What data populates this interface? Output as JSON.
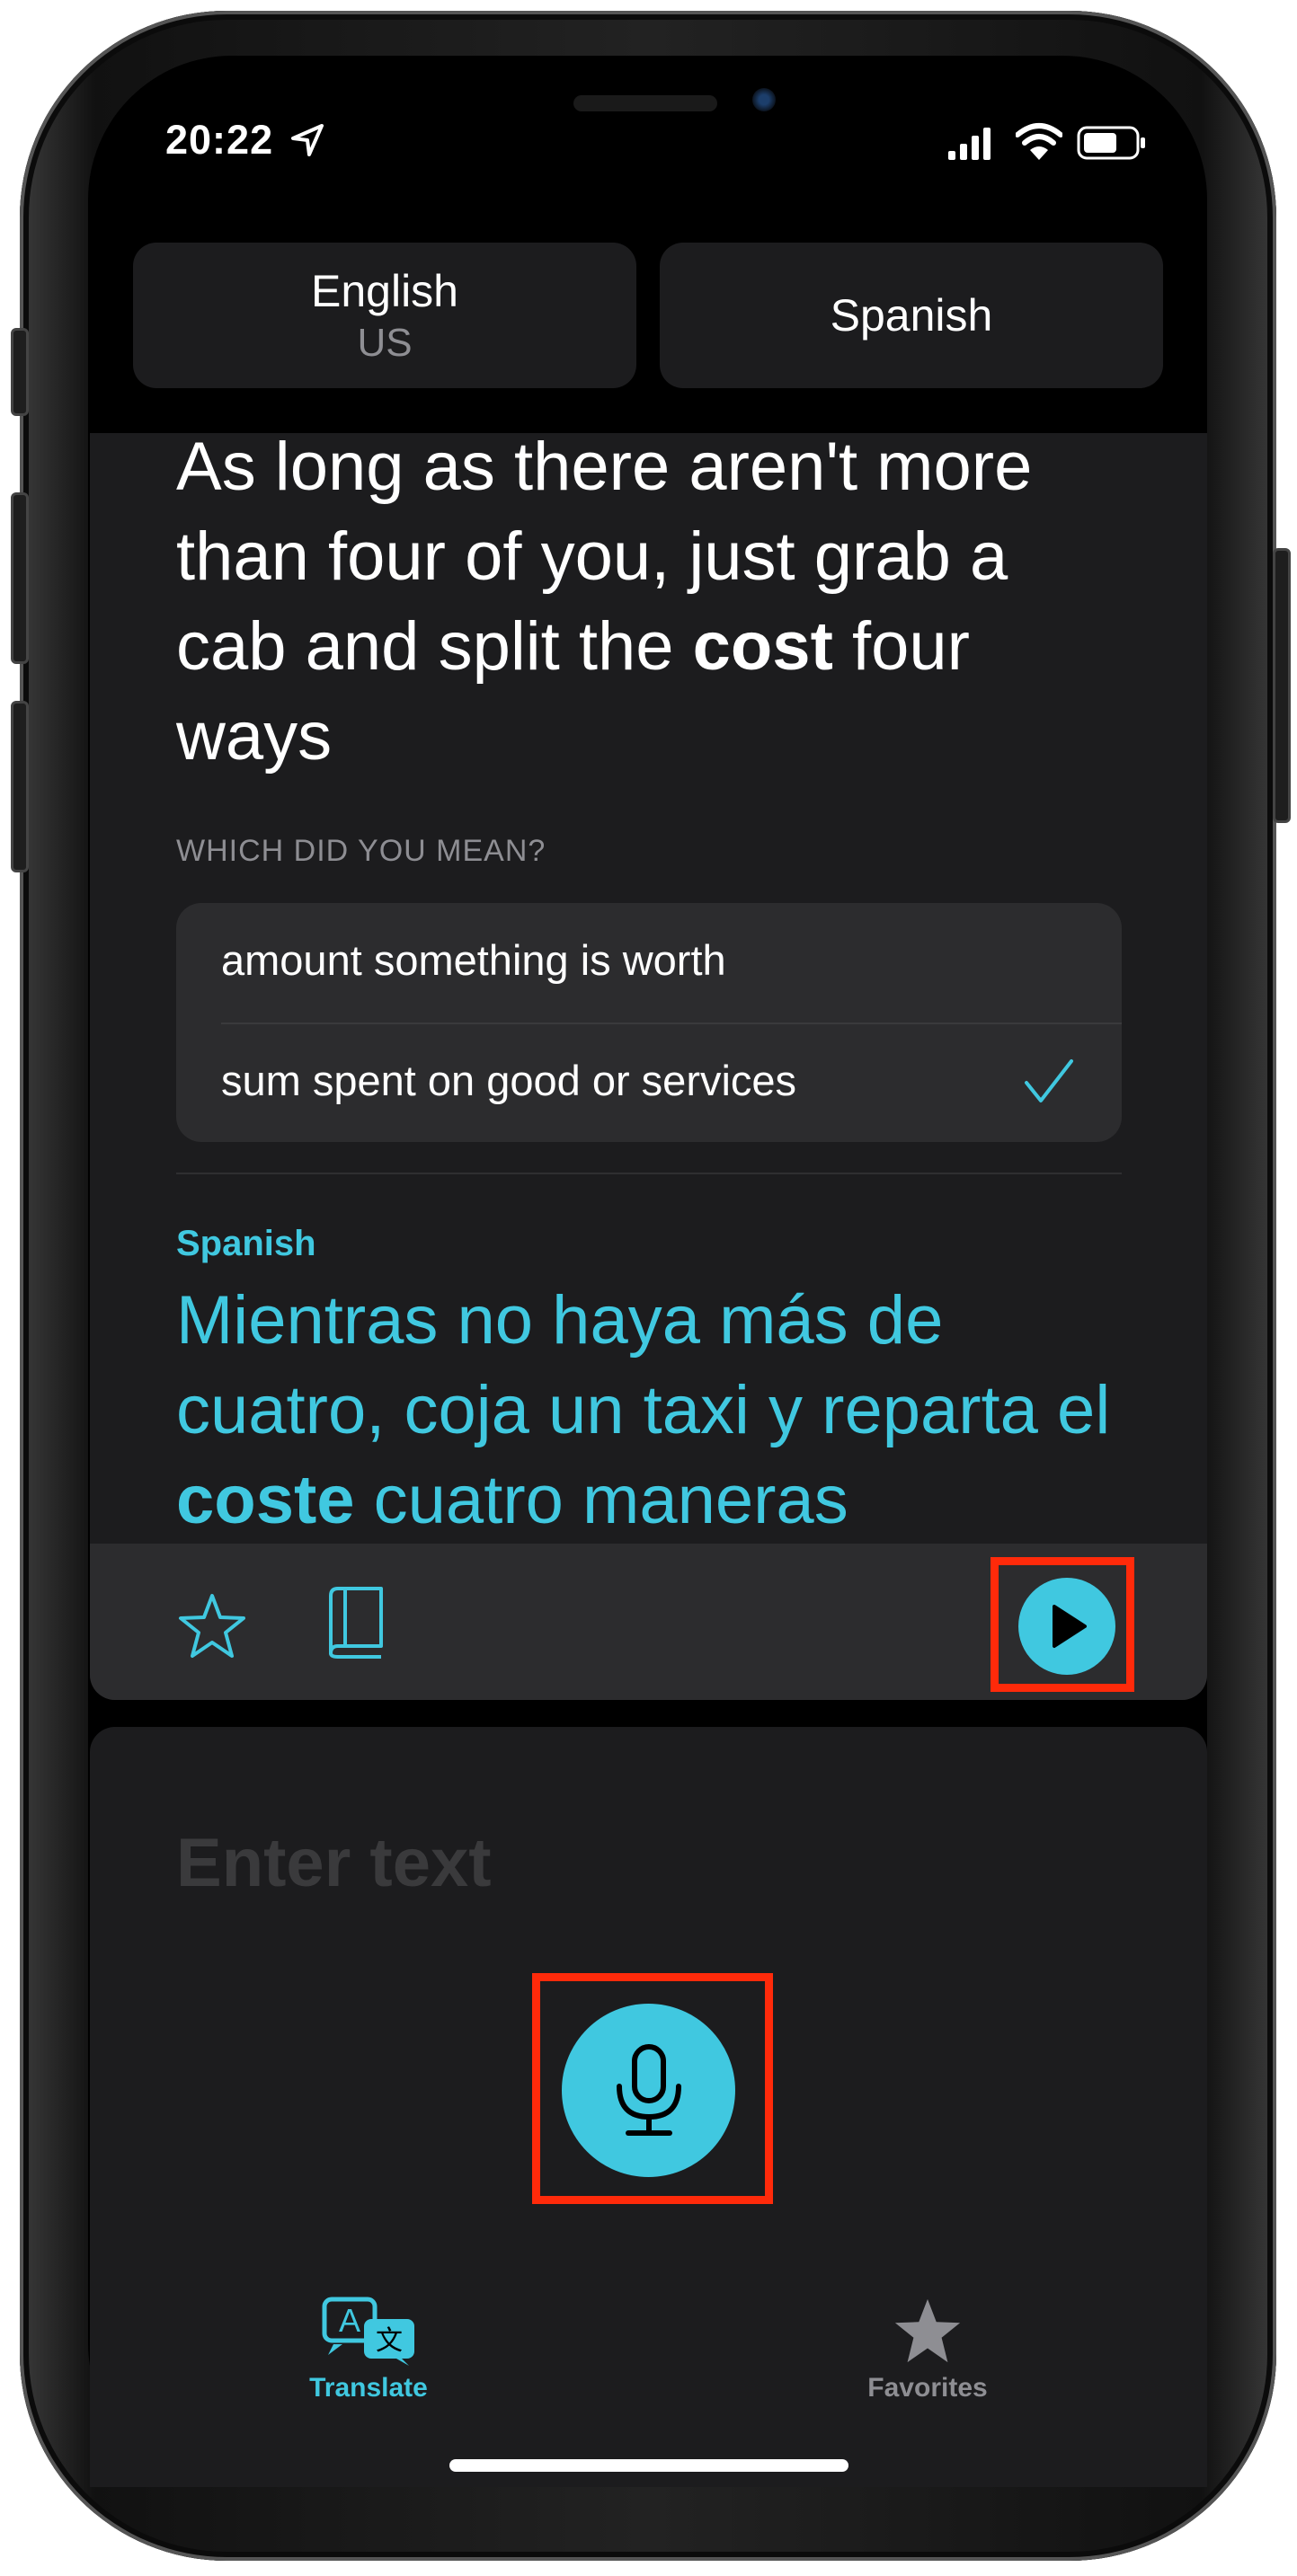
{
  "status_bar": {
    "time": "20:22"
  },
  "languages": {
    "source": {
      "name": "English",
      "region": "US"
    },
    "target": {
      "name": "Spanish"
    }
  },
  "source_text": {
    "before": "As long as there aren't more than four of you, just grab a cab and split the ",
    "highlight": "cost",
    "after": " four ways"
  },
  "disambiguation": {
    "heading": "WHICH DID YOU MEAN?",
    "options": [
      {
        "label": "amount something is worth",
        "selected": false
      },
      {
        "label": "sum spent on good or services",
        "selected": true
      }
    ]
  },
  "translation": {
    "language": "Spanish",
    "before": "Mientras no haya más de cuatro, coja un taxi y reparta el ",
    "highlight": "coste",
    "after": " cuatro maneras"
  },
  "input": {
    "placeholder": "Enter text"
  },
  "tabs": [
    {
      "label": "Translate",
      "icon": "translate-icon",
      "active": true
    },
    {
      "label": "Favorites",
      "icon": "star-icon",
      "active": false
    }
  ],
  "colors": {
    "accent": "#40c8e0",
    "highlight_box": "#ff2a0a",
    "background": "#000000",
    "card": "#1c1c1e"
  }
}
